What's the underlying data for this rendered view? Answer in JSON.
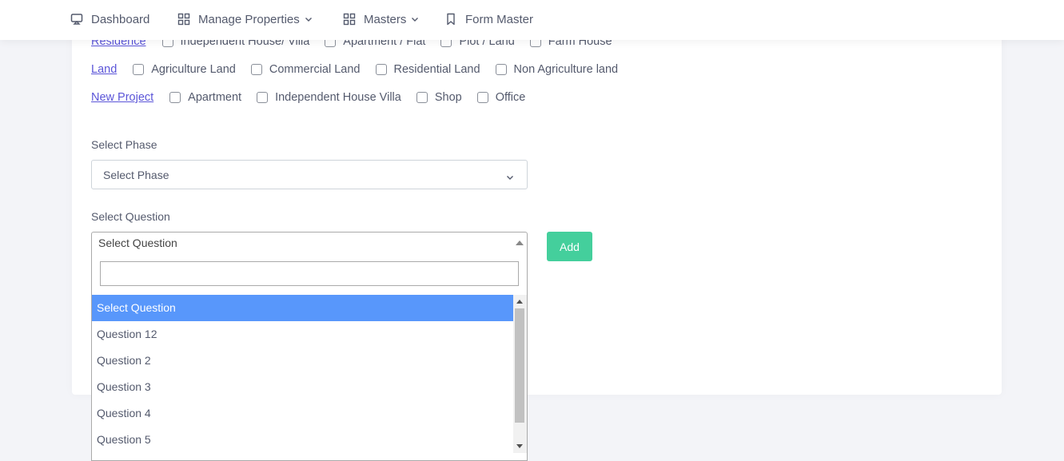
{
  "nav": {
    "items": [
      {
        "label": "Dashboard",
        "icon": "monitor-icon",
        "has_dropdown": false
      },
      {
        "label": "Manage Properties",
        "icon": "grid-icon",
        "has_dropdown": true
      },
      {
        "label": "Masters",
        "icon": "grid-icon",
        "has_dropdown": true
      },
      {
        "label": "Form Master",
        "icon": "bookmark-icon",
        "has_dropdown": false
      }
    ]
  },
  "categories": [
    {
      "name": "Residence",
      "options": [
        "Independent House/ Villa",
        "Apartment / Flat",
        "Plot / Land",
        "Farm House"
      ]
    },
    {
      "name": "Land",
      "options": [
        "Agriculture Land",
        "Commercial Land",
        "Residential Land",
        "Non Agriculture land"
      ]
    },
    {
      "name": "New Project",
      "options": [
        "Apartment",
        "Independent House Villa",
        "Shop",
        "Office"
      ]
    }
  ],
  "phase": {
    "label": "Select Phase",
    "placeholder": "Select Phase"
  },
  "question": {
    "label": "Select Question",
    "selected": "Select Question",
    "search_value": "",
    "options": [
      "Select Question",
      "Question 12",
      "Question 2",
      "Question 3",
      "Question 4",
      "Question 5"
    ]
  },
  "add_button": "Add",
  "colors": {
    "accent_button": "#44cf9c",
    "highlight_option": "#5897fb",
    "link": "#5b55d8"
  }
}
